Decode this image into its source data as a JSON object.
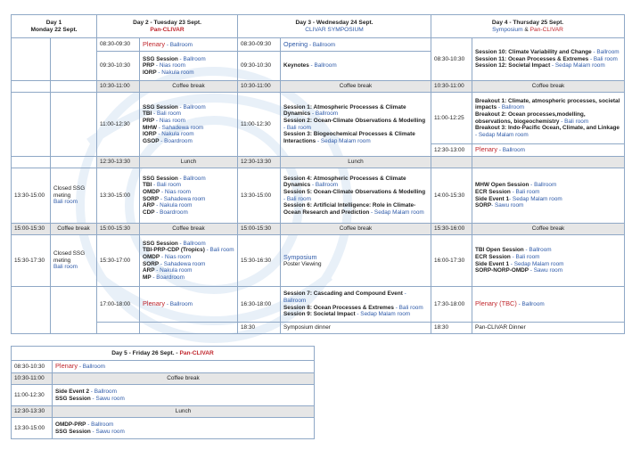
{
  "days": {
    "d1": {
      "title": "Day 1",
      "sub": "Monday 22 Sept."
    },
    "d2": {
      "title": "Day 2 - Tuesday 23 Sept.",
      "sub": "Pan-CLIVAR"
    },
    "d3": {
      "title": "Day 3 - Wednesday 24 Sept.",
      "sub": "CLIVAR SYMPOSIUM"
    },
    "d4": {
      "title": "Day 4 - Thursday 25 Sept.",
      "sub_a": "Symposium",
      "sub_amp": " & ",
      "sub_b": "Pan-CLIVAR"
    },
    "d5": {
      "title_a": "Day 5 - Friday 26 Sept. - ",
      "title_b": "Pan-CLIVAR"
    }
  },
  "rows": {
    "r1": {
      "d2_time": "08:30-09:30",
      "d2_a": "Plenary",
      "d2_b": " - Ballroom",
      "d3_time": "08:30-09:30",
      "d3_a": "Opening",
      "d3_b": " - Ballroom"
    },
    "r2": {
      "d2_time": "09:30-10:30",
      "d3_time": "09:30-10:30",
      "d3_a": "Keynotes",
      "d3_b": " - Ballroom",
      "d4_time": "08:30-10:30"
    },
    "r3": {
      "d2_time": "10:30-11:00",
      "d2_break": "Coffee break",
      "d3_time": "10:30-11:00",
      "d3_break": "Coffee break",
      "d4_time": "10:30-11:00",
      "d4_break": "Coffee break"
    },
    "r4": {
      "d2_time": "11:00-12:30",
      "d3_time": "11:00-12:30",
      "d4_time": "11:00-12:25"
    },
    "r4b": {
      "d4_time": "12:30-13:00",
      "d4_a": "Plenary",
      "d4_b": " - Ballroom"
    },
    "r5": {
      "d2_time": "12:30-13:30",
      "d2_break": "Lunch",
      "d3_time": "12:30-13:30",
      "d3_break": "Lunch"
    },
    "r6": {
      "d1_time": "13:30-15:00",
      "d1_a": "Closed SSG meting",
      "d1_b": "Bali room",
      "d2_time": "13:30-15:00",
      "d3_time": "13:30-15:00",
      "d4_time": "14:00-15:30"
    },
    "r7": {
      "d1_time": "15:00-15:30",
      "d1_break": "Coffee break",
      "d2_time": "15:00-15:30",
      "d2_break": "Coffee break",
      "d3_time": "15:00-15:30",
      "d3_break": "Coffee break",
      "d4_time": "15:30-16:00",
      "d4_break": "Coffee break"
    },
    "r8": {
      "d1_time": "15:30-17:30",
      "d1_a": "Closed SSG meting",
      "d1_b": "Bali room",
      "d2_time": "15:30-17:00",
      "d3_time": "15:30-16:30",
      "d3_a": "Symposium",
      "d3_b": "Poster Viewing",
      "d4_time": "16:00-17:30"
    },
    "r9": {
      "d2_time": "17:00-18:00",
      "d2_a": "Plenary",
      "d2_b": " - Ballroom",
      "d3_time": "16:30-18:00",
      "d4_time": "17:30-18:00",
      "d4_a": "Plenary (TBC)",
      "d4_b": " - Ballroom"
    },
    "r10": {
      "d3_time": "18:30",
      "d3_a": "Symposium dinner",
      "d4_time": "18:30",
      "d4_a": "Pan-CLIVAR Dinner"
    }
  },
  "sessions": {
    "d2_r2": [
      {
        "name": "SSG Session",
        "room": " - Ballroom"
      },
      {
        "name": "PRP",
        "room": " - Nias room"
      },
      {
        "name": "IORP",
        "room": " - Nakula room"
      }
    ],
    "d4_r2": [
      {
        "name": "Session 10: Climate Variability and Change",
        "room": " - Ballroom"
      },
      {
        "name": "Session 11: Ocean Processes & Extremes",
        "room": " - Bali room"
      },
      {
        "name": "Session 12: Societal Impact",
        "room": " - Sedap Malam room"
      }
    ],
    "d2_r4": [
      {
        "name": "SSG Session",
        "room": " - Ballroom"
      },
      {
        "name": "TBI",
        "room": " - Bali room"
      },
      {
        "name": "PRP",
        "room": " - Nias room"
      },
      {
        "name": "MHW",
        "room": " - Sahadewa room"
      },
      {
        "name": "IORP",
        "room": " - Nakula room"
      },
      {
        "name": "GSOP",
        "room": " - Boardroom"
      }
    ],
    "d3_r4": [
      {
        "name": "Session 1: Atmospheric Processes & Climate Dynamics",
        "room": " - Ballroom"
      },
      {
        "name": "Session 2: Ocean-Climate Observations & Modelling",
        "room": " - Bali room"
      },
      {
        "name": "Session 3: Biogeochemical Processes & Climate Interactions",
        "room": " - Sedap Malam room"
      }
    ],
    "d4_r4": [
      {
        "name": "Breakout 1: Climate, atmospheric processes, societal impacts",
        "room": " - Ballroom"
      },
      {
        "name": "Breakout 2: Ocean processes,modelling, observations, biogeochemistry",
        "room": " - Bali room"
      },
      {
        "name": "Breakout 3: Indo-Pacific Ocean, Climate, and Linkage",
        "room": " - Sedap Malam room"
      }
    ],
    "d2_r6": [
      {
        "name": "SSG Session",
        "room": " - Ballroom"
      },
      {
        "name": "TBI",
        "room": " - Bali room"
      },
      {
        "name": "OMDP",
        "room": " - Nias room"
      },
      {
        "name": "SORP",
        "room": " - Sahadewa room"
      },
      {
        "name": "ARP",
        "room": " - Nakula room"
      },
      {
        "name": "CDP",
        "room": " - Boardroom"
      }
    ],
    "d3_r6": [
      {
        "name": "Session 4: Atmospheric Processes & Climate Dynamics",
        "room": " - Ballroom"
      },
      {
        "name": "Session 5: Ocean-Climate Observations & Modelling",
        "room": " - Bali room"
      },
      {
        "name": "Session 6: Artificial Intelligence: Role in Climate-Ocean Research and Prediction",
        "room": " - Sedap Malam room"
      }
    ],
    "d4_r6": [
      {
        "name": "MHW Open Session",
        "room": " - Ballroom"
      },
      {
        "name": "ECR Session",
        "room": " - Bali room"
      },
      {
        "name": "Side Event 1",
        "room": "- Sedap Malam room"
      },
      {
        "name": "SORP",
        "room": "- Sawu room"
      }
    ],
    "d2_r8": [
      {
        "name": "SSG Session",
        "room": " - Ballroom"
      },
      {
        "name": "TBI-PRP-CDP (Tropics)",
        "room": " - Bali room"
      },
      {
        "name": "OMDP",
        "room": " - Nias room"
      },
      {
        "name": "SORP",
        "room": " - Sahadewa room"
      },
      {
        "name": "ARP",
        "room": " - Nakula room"
      },
      {
        "name": "MP",
        "room": " - Boardroom"
      }
    ],
    "d4_r8": [
      {
        "name": "TBI Open Session",
        "room": " - Ballroom"
      },
      {
        "name": "ECR Session",
        "room": " - Bali room"
      },
      {
        "name": "Side Event 1",
        "room": " - Sedap Malam room"
      },
      {
        "name": "SORP-NORP-OMDP",
        "room": " - Sawu room"
      }
    ],
    "d3_r9": [
      {
        "name": "Session 7: Cascading and Compound Event",
        "room": " - Ballroom"
      },
      {
        "name": "Session 8: Ocean Processes & Extremes",
        "room": " - Bali room"
      },
      {
        "name": "Session 9: Societal Impact",
        "room": " - Sedap Malam room"
      }
    ]
  },
  "day5": {
    "r1_time": "08:30-10:30",
    "r1_a": "Plenary",
    "r1_b": " - Ballroom",
    "r2_time": "10:30-11:00",
    "r2_break": "Coffee break",
    "r3_time": "11:00-12:30",
    "r3": [
      {
        "name": "Side Event 2",
        "room": " - Ballroom"
      },
      {
        "name": "SSG Session",
        "room": " - Sawu room"
      }
    ],
    "r4_time": "12:30-13:30",
    "r4_break": "Lunch",
    "r5_time": "13:30-15:00",
    "r5": [
      {
        "name": "OMDP-PRP",
        "room": " - Ballroom"
      },
      {
        "name": "SSG Session",
        "room": " - Sawu room"
      }
    ]
  },
  "colors": {
    "accent_red": "#c0272d",
    "accent_blue": "#2e5aa8",
    "break_grey": "#e6e6e6",
    "border": "#8fa8c6"
  }
}
